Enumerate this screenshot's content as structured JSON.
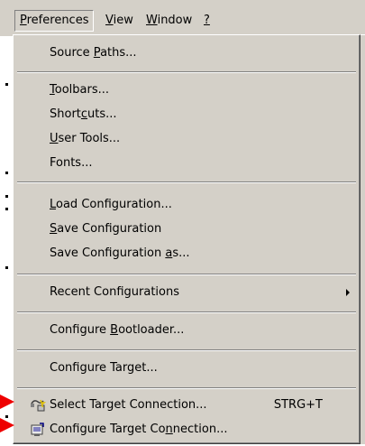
{
  "menubar": {
    "preferences": "Preferences",
    "view": "View",
    "window": "Window",
    "help": "?"
  },
  "menu": {
    "source_paths": "Source Paths...",
    "toolbars": "Toolbars...",
    "shortcuts": "Shortcuts...",
    "user_tools": "User Tools...",
    "fonts": "Fonts...",
    "load_configuration": "Load Configuration...",
    "save_configuration": "Save Configuration",
    "save_configuration_as": "Save Configuration as...",
    "recent_configurations": "Recent Configurations",
    "configure_bootloader": "Configure Bootloader...",
    "configure_target": "Configure Target...",
    "select_target_connection": "Select Target Connection...",
    "select_target_connection_shortcut": "STRG+T",
    "configure_target_connection": "Configure Target Connection..."
  },
  "icons": {
    "select_target_connection": "select-connection-icon",
    "configure_target_connection": "configure-connection-icon",
    "submenu": "submenu-arrow-icon"
  },
  "colors": {
    "menu_background": "#d4d0c8",
    "annotation_arrow": "#ee0000"
  }
}
